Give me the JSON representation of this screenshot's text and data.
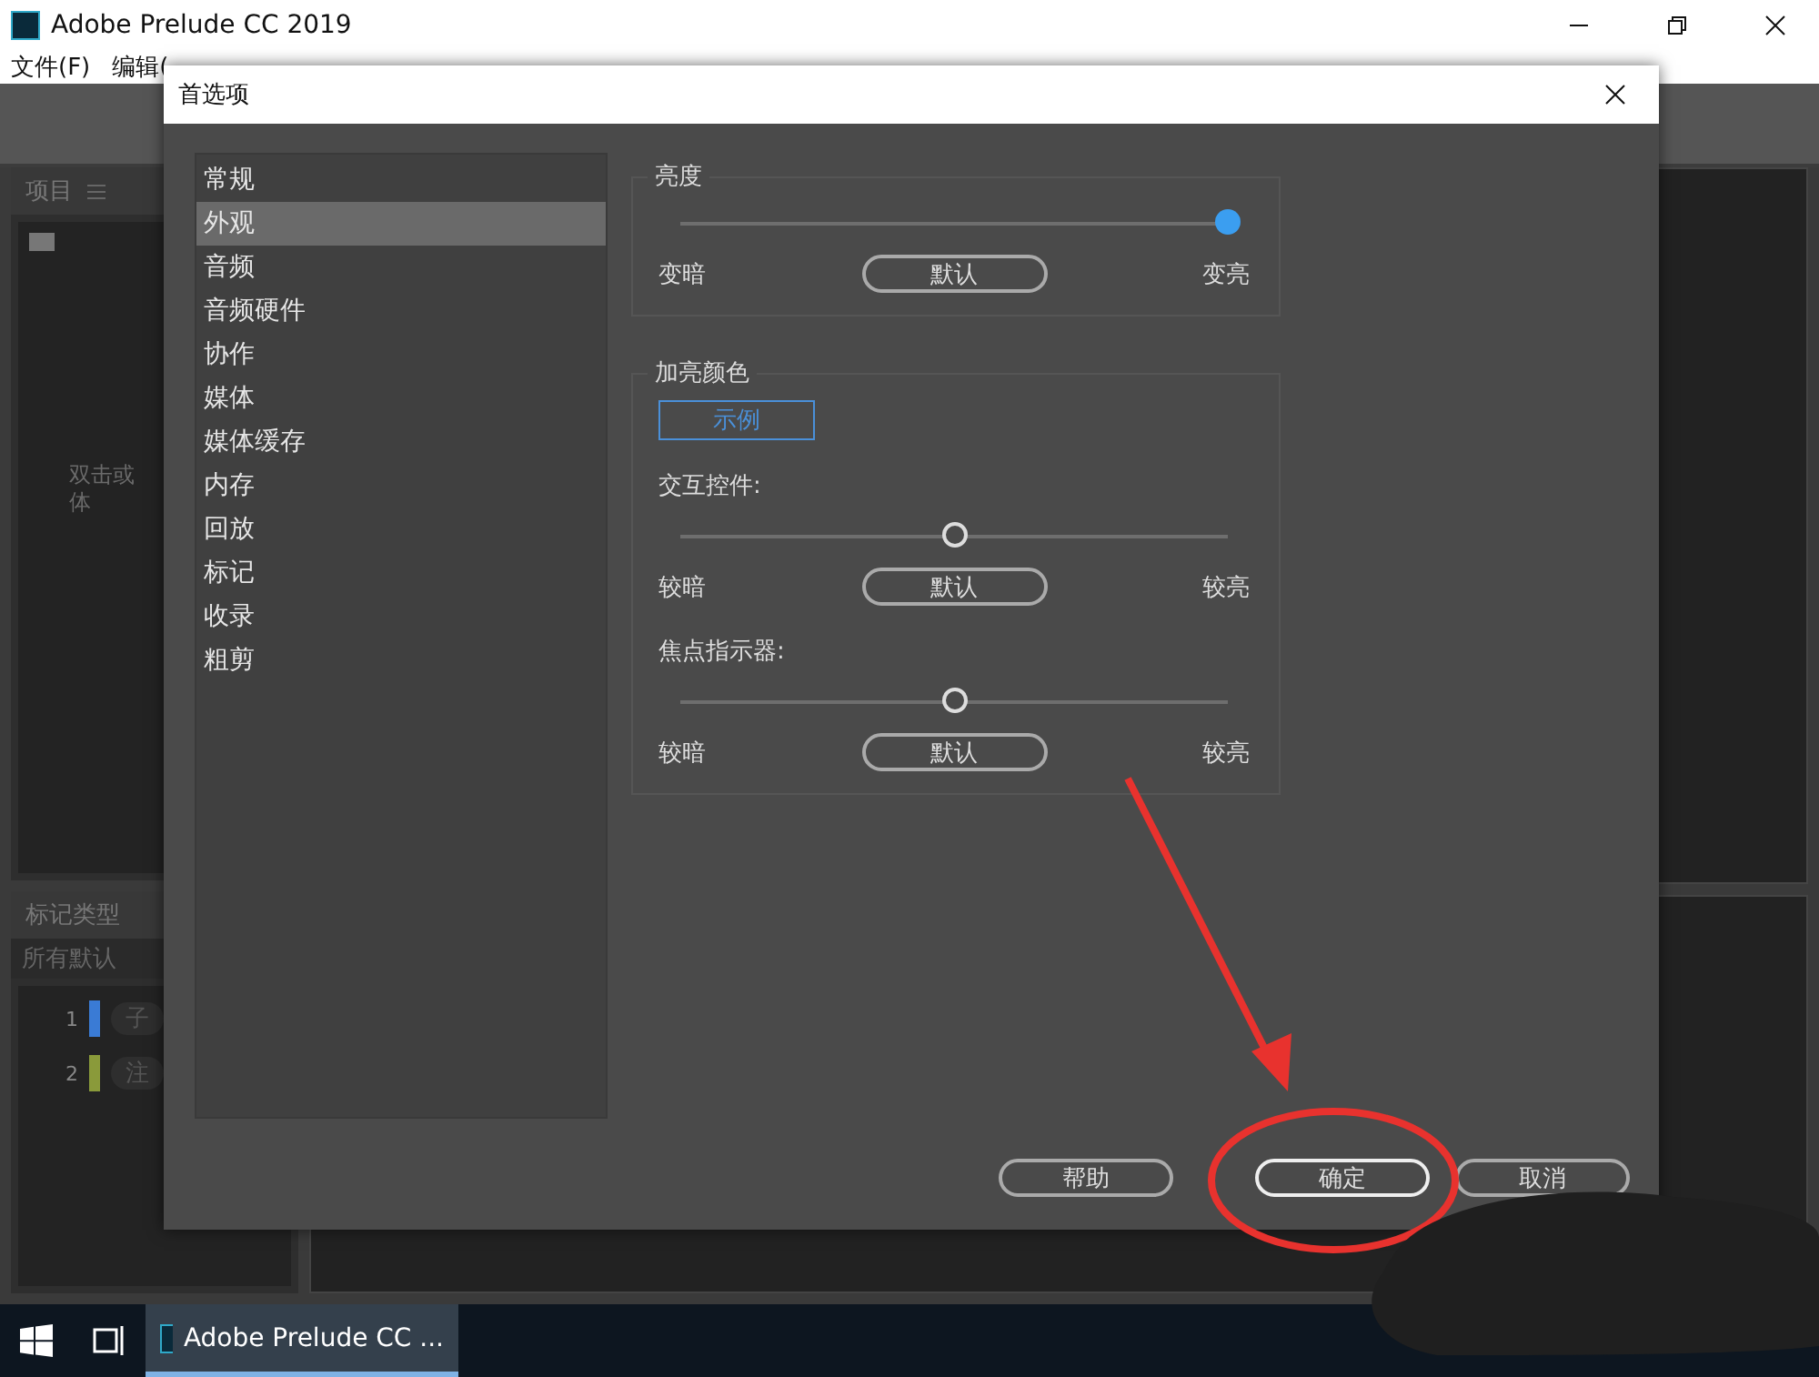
{
  "window": {
    "title": "Adobe Prelude CC 2019"
  },
  "menu": [
    "文件(F)",
    "编辑("
  ],
  "project_panel": {
    "title": "项目",
    "hint_lines": [
      "双击或",
      "体"
    ]
  },
  "marker_panel": {
    "title": "标记类型",
    "filter": "所有默认",
    "rows": [
      {
        "number": "1",
        "color": "#3a7bd5",
        "label": "子"
      },
      {
        "number": "2",
        "color": "#8a9a3a",
        "label": "注"
      }
    ]
  },
  "dialog": {
    "title": "首选项",
    "categories": [
      {
        "label": "常规",
        "selected": false
      },
      {
        "label": "外观",
        "selected": true
      },
      {
        "label": "音频",
        "selected": false
      },
      {
        "label": "音频硬件",
        "selected": false
      },
      {
        "label": "协作",
        "selected": false
      },
      {
        "label": "媒体",
        "selected": false
      },
      {
        "label": "媒体缓存",
        "selected": false
      },
      {
        "label": "内存",
        "selected": false
      },
      {
        "label": "回放",
        "selected": false
      },
      {
        "label": "标记",
        "selected": false
      },
      {
        "label": "收录",
        "selected": false
      },
      {
        "label": "粗剪",
        "selected": false
      }
    ],
    "brightness": {
      "title": "亮度",
      "slider": {
        "level": 1.0,
        "focused": true,
        "low": "变暗",
        "default": "默认",
        "high": "变亮"
      }
    },
    "highlight": {
      "title": "加亮颜色",
      "sample": "示例",
      "sliders": [
        {
          "label": "交互控件:",
          "level": 0.5,
          "focused": false,
          "low": "较暗",
          "default": "默认",
          "high": "较亮"
        },
        {
          "label": "焦点指示器:",
          "level": 0.5,
          "focused": false,
          "low": "较暗",
          "default": "默认",
          "high": "较亮"
        }
      ]
    },
    "buttons": [
      {
        "label": "帮助",
        "primary": false
      },
      {
        "label": "确定",
        "primary": true
      },
      {
        "label": "取消",
        "primary": false
      }
    ]
  },
  "taskbar": {
    "apps": [
      {
        "label": "Adobe Prelude CC ...",
        "selected": true
      }
    ]
  }
}
